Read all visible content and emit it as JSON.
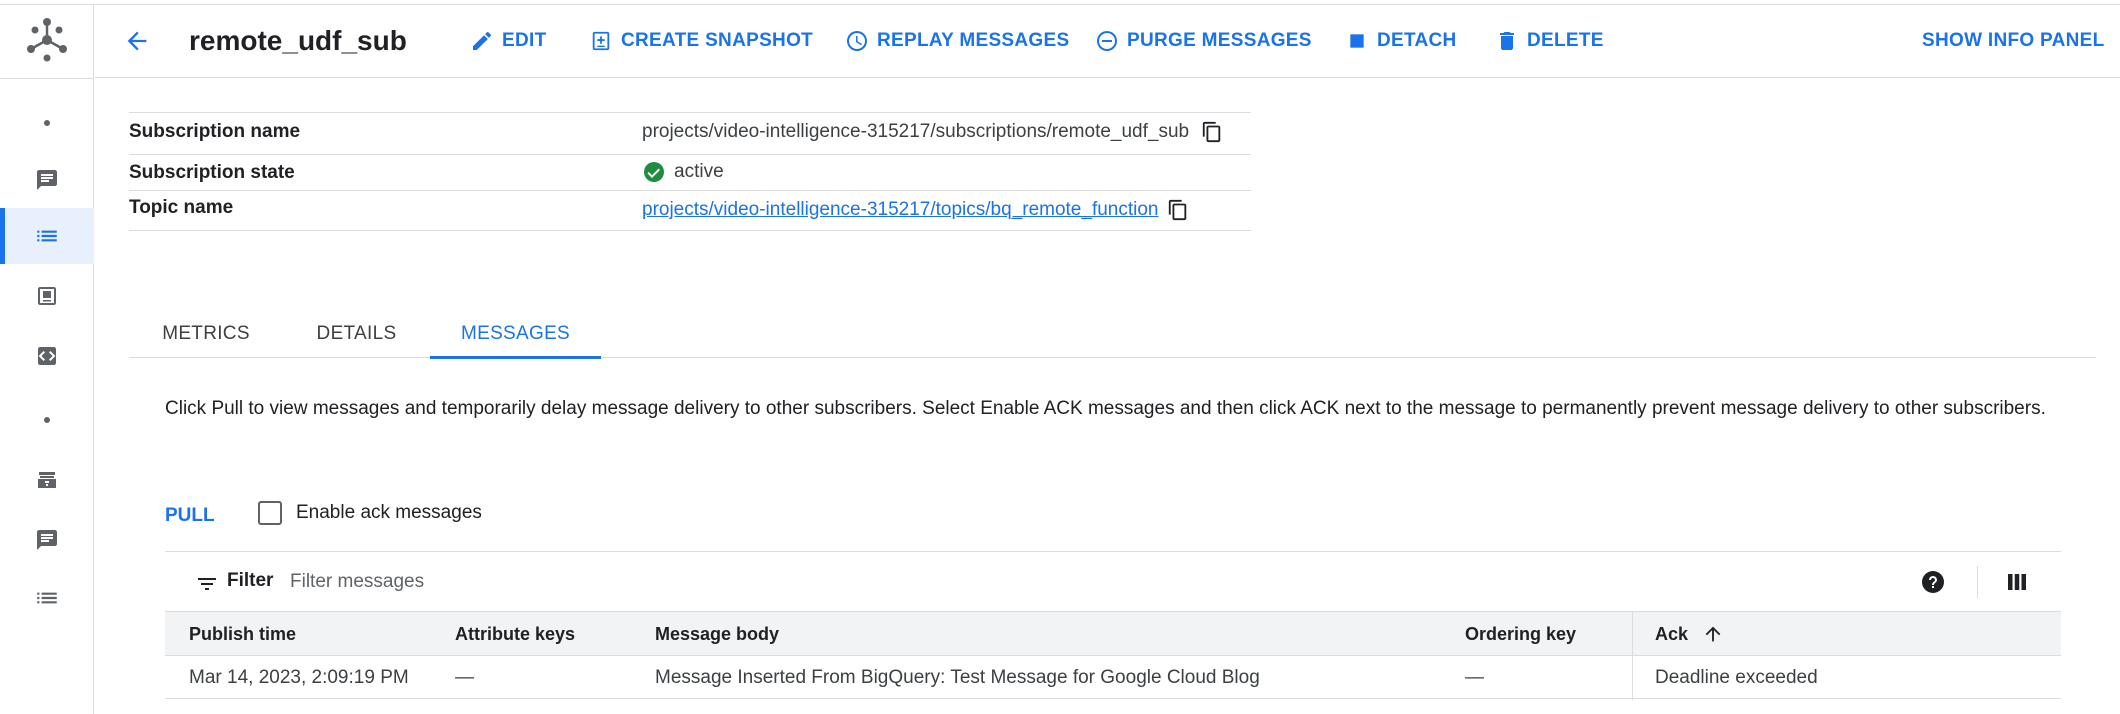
{
  "header": {
    "title": "remote_udf_sub",
    "actions": {
      "edit": "EDIT",
      "snapshot": "CREATE SNAPSHOT",
      "replay": "REPLAY MESSAGES",
      "purge": "PURGE MESSAGES",
      "detach": "DETACH",
      "delete": "DELETE",
      "info_panel": "SHOW INFO PANEL"
    }
  },
  "properties": {
    "subscription_name_label": "Subscription name",
    "subscription_name_value": "projects/video-intelligence-315217/subscriptions/remote_udf_sub",
    "subscription_state_label": "Subscription state",
    "subscription_state_value": "active",
    "topic_name_label": "Topic name",
    "topic_name_value": "projects/video-intelligence-315217/topics/bq_remote_function"
  },
  "tabs": [
    {
      "label": "METRICS"
    },
    {
      "label": "DETAILS"
    },
    {
      "label": "MESSAGES"
    }
  ],
  "messages": {
    "description": "Click Pull to view messages and temporarily delay message delivery to other subscribers. Select Enable ACK messages and then click ACK next to the message to permanently prevent message delivery to other subscribers.",
    "pull_label": "PULL",
    "enable_ack_label": "Enable ack messages",
    "filter_label": "Filter",
    "filter_placeholder": "Filter messages",
    "columns": {
      "publish_time": "Publish time",
      "attribute_keys": "Attribute keys",
      "message_body": "Message body",
      "ordering_key": "Ordering key",
      "ack": "Ack"
    },
    "rows": [
      {
        "publish_time": "Mar 14, 2023, 2:09:19 PM",
        "attribute_keys": "—",
        "message_body": "Message Inserted From BigQuery: Test Message for Google Cloud Blog",
        "ordering_key": "—",
        "ack": "Deadline exceeded"
      }
    ]
  },
  "colors": {
    "accent": "#1a73e8",
    "success": "#1e8e3e",
    "icon": "#5f6368"
  }
}
